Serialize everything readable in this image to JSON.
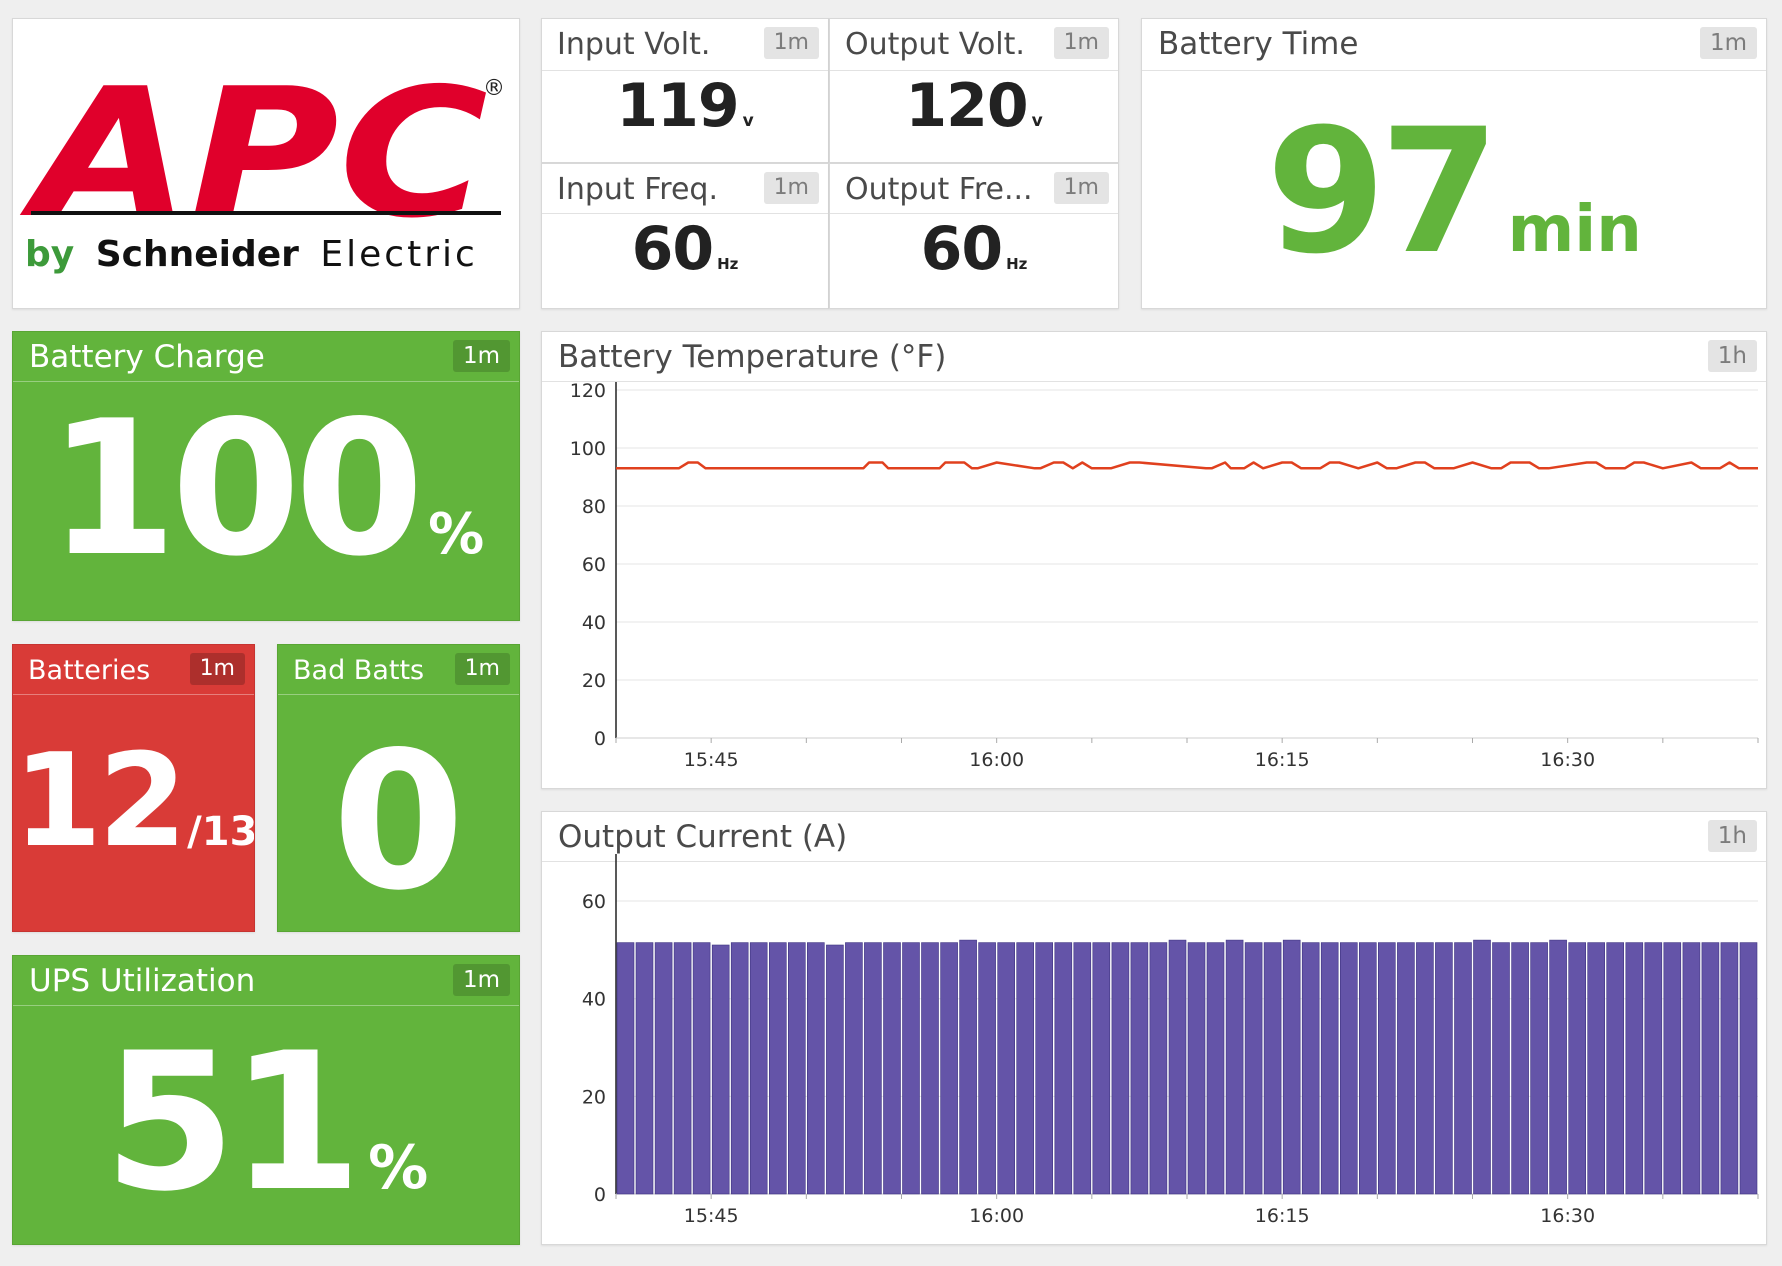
{
  "logo": {
    "brand": "APC",
    "tagline_by": "by",
    "tagline_company": "Schneider",
    "tagline_electric": "Electric",
    "registered": "®",
    "brand_color": "#e0002b"
  },
  "input_volt": {
    "title": "Input Volt.",
    "badge": "1m",
    "value": "119",
    "unit": "v"
  },
  "output_volt": {
    "title": "Output Volt.",
    "badge": "1m",
    "value": "120",
    "unit": "v"
  },
  "input_freq": {
    "title": "Input Freq.",
    "badge": "1m",
    "value": "60",
    "unit": "Hz"
  },
  "output_freq": {
    "title": "Output Fre...",
    "badge": "1m",
    "value": "60",
    "unit": "Hz"
  },
  "battery_time": {
    "title": "Battery Time",
    "badge": "1m",
    "value": "97",
    "unit": "min",
    "color": "#62b43c"
  },
  "battery_charge": {
    "title": "Battery Charge",
    "badge": "1m",
    "value": "100",
    "unit": "%",
    "color": "#62b43c"
  },
  "batteries": {
    "title": "Batteries",
    "badge": "1m",
    "value": "12",
    "unit": "/13",
    "color": "#d93b37"
  },
  "bad_batts": {
    "title": "Bad Batts",
    "badge": "1m",
    "value": "0",
    "color": "#62b43c"
  },
  "ups_utilization": {
    "title": "UPS Utilization",
    "badge": "1m",
    "value": "51",
    "unit": "%",
    "color": "#62b43c"
  },
  "temp_chart": {
    "title": "Battery Temperature (°F)",
    "badge": "1h"
  },
  "current_chart": {
    "title": "Output Current (A)",
    "badge": "1h"
  },
  "chart_data": [
    {
      "type": "line",
      "title": "Battery Temperature (°F)",
      "ylim": [
        0,
        120
      ],
      "y_ticks": [
        "0",
        "20",
        "40",
        "60",
        "80",
        "100",
        "120"
      ],
      "x_ticks": [
        "15:45",
        "16:00",
        "16:15",
        "16:30"
      ],
      "x_tick_minutes": [
        45,
        60,
        75,
        90
      ],
      "x_range_minutes": [
        40,
        100
      ],
      "grid": true,
      "color": "#e0401e",
      "series": [
        {
          "x_minutes": [
            40,
            43.3,
            43.8,
            44.3,
            44.7,
            53,
            53.3,
            54,
            54.3,
            55,
            56,
            57,
            57.3,
            58.3,
            58.7,
            59,
            60,
            62,
            62.3,
            63,
            63.5,
            64,
            64.5,
            65,
            66,
            67,
            67.5,
            71,
            71.3,
            72,
            72.3,
            73,
            73.5,
            74,
            75,
            75.5,
            76,
            77,
            77.5,
            78,
            79,
            80,
            80.5,
            81,
            82,
            82.5,
            83,
            84,
            85,
            86,
            86.5,
            87,
            88,
            88.5,
            89,
            91,
            91.5,
            92,
            93,
            93.5,
            94,
            95,
            96.5,
            97,
            98,
            98.5,
            99,
            100
          ],
          "values": [
            93,
            93,
            95,
            95,
            93,
            93,
            95,
            95,
            93,
            93,
            93,
            93,
            95,
            95,
            93,
            93,
            95,
            93,
            93,
            95,
            95,
            93,
            95,
            93,
            93,
            95,
            95,
            93,
            93,
            95,
            93,
            93,
            95,
            93,
            95,
            95,
            93,
            93,
            95,
            95,
            93,
            95,
            93,
            93,
            95,
            95,
            93,
            93,
            95,
            93,
            93,
            95,
            95,
            93,
            93,
            95,
            95,
            93,
            93,
            95,
            95,
            93,
            95,
            93,
            93,
            95,
            93,
            93
          ]
        }
      ]
    },
    {
      "type": "bar",
      "title": "Output Current (A)",
      "ylim": [
        0,
        68
      ],
      "y_ticks": [
        "0",
        "20",
        "40",
        "60"
      ],
      "x_ticks": [
        "15:45",
        "16:00",
        "16:15",
        "16:30"
      ],
      "x_tick_minutes": [
        45,
        60,
        75,
        90
      ],
      "x_range_minutes": [
        40,
        100
      ],
      "grid": true,
      "color": "#6454a8",
      "series": [
        {
          "values": [
            51.5,
            51.5,
            51.5,
            51.5,
            51.5,
            51,
            51.5,
            51.5,
            51.5,
            51.5,
            51.5,
            51,
            51.5,
            51.5,
            51.5,
            51.5,
            51.5,
            51.5,
            52,
            51.5,
            51.5,
            51.5,
            51.5,
            51.5,
            51.5,
            51.5,
            51.5,
            51.5,
            51.5,
            52,
            51.5,
            51.5,
            52,
            51.5,
            51.5,
            52,
            51.5,
            51.5,
            51.5,
            51.5,
            51.5,
            51.5,
            51.5,
            51.5,
            51.5,
            52,
            51.5,
            51.5,
            51.5,
            52,
            51.5,
            51.5,
            51.5,
            51.5,
            51.5,
            51.5,
            51.5,
            51.5,
            51.5,
            51.5
          ]
        }
      ]
    }
  ]
}
